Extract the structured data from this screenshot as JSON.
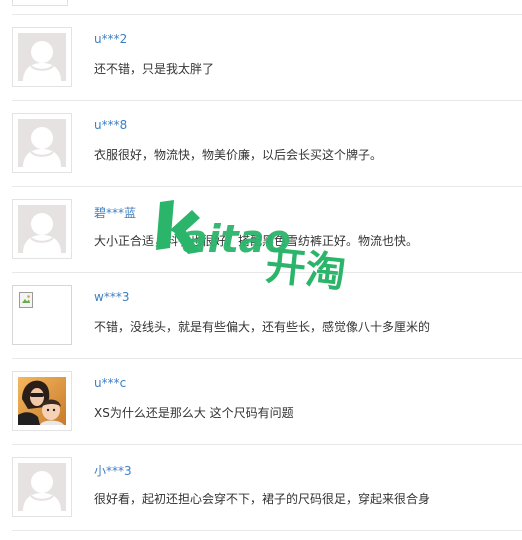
{
  "watermark": {
    "text_latin": "kaitao",
    "text_cjk": "开淘",
    "color": "#2bb56a"
  },
  "colors": {
    "username": "#3d7ec2",
    "comment": "#333333",
    "divider": "#e8e8e8",
    "avatar_placeholder": "#e6e2e2"
  },
  "reviews": [
    {
      "username": "u***2",
      "comment": "还不错，只是我太胖了",
      "avatar": "default-avatar"
    },
    {
      "username": "u***8",
      "comment": "衣服很好，物流快，物美价廉，以后会长买这个牌子。",
      "avatar": "default-avatar"
    },
    {
      "username": "碧***蓝",
      "comment": "大小正合适，料子也很好。搭配黑色雪纺裤正好。物流也快。",
      "avatar": "default-avatar"
    },
    {
      "username": "w***3",
      "comment": "不错，没线头，就是有些偏大，还有些长，感觉像八十多厘米的",
      "avatar": "broken-image"
    },
    {
      "username": "u***c",
      "comment": "XS为什么还是那么大 这个尺码有问题",
      "avatar": "user-photo"
    },
    {
      "username": "小***3",
      "comment": "很好看，起初还担心会穿不下，裙子的尺码很足，穿起来很合身",
      "avatar": "default-avatar"
    }
  ]
}
